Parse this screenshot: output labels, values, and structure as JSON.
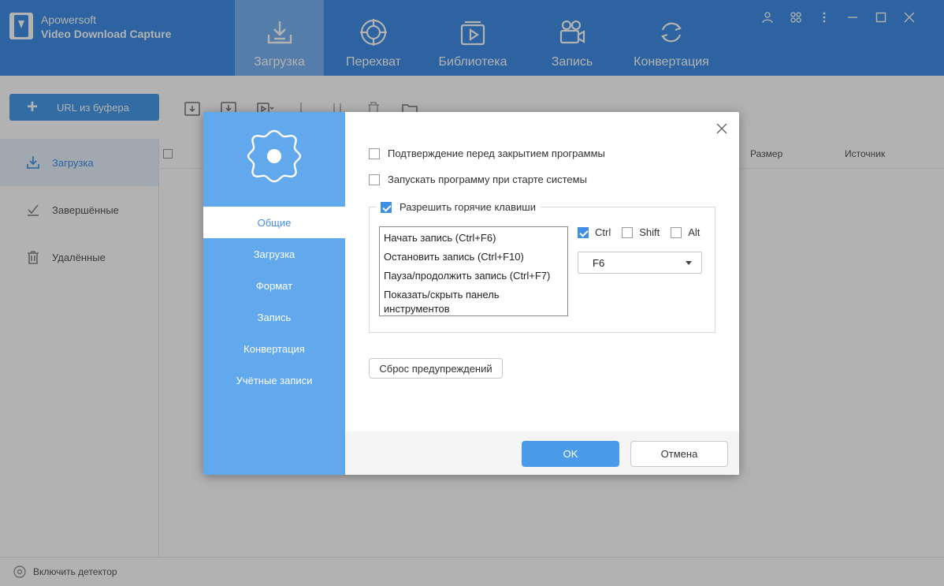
{
  "app": {
    "brand_line1": "Apowersoft",
    "brand_line2": "Video Download Capture",
    "tabs": [
      {
        "label": "Загрузка",
        "icon": "download-icon",
        "active": true
      },
      {
        "label": "Перехват",
        "icon": "crosshair-icon",
        "active": false
      },
      {
        "label": "Библиотека",
        "icon": "library-icon",
        "active": false
      },
      {
        "label": "Запись",
        "icon": "camera-icon",
        "active": false
      },
      {
        "label": "Конвертация",
        "icon": "convert-icon",
        "active": false
      }
    ],
    "url_button_label": "URL из буфера",
    "sidebar": [
      {
        "label": "Загрузка",
        "icon": "download-icon",
        "active": true
      },
      {
        "label": "Завершённые",
        "icon": "check-icon",
        "active": false
      },
      {
        "label": "Удалённые",
        "icon": "trash-icon",
        "active": false
      }
    ],
    "columns": {
      "size": "Размер",
      "source": "Источник"
    },
    "detector_label": "Включить детектор"
  },
  "dialog": {
    "menu": [
      {
        "label": "Общие",
        "active": true
      },
      {
        "label": "Загрузка",
        "active": false
      },
      {
        "label": "Формат",
        "active": false
      },
      {
        "label": "Запись",
        "active": false
      },
      {
        "label": "Конвертация",
        "active": false
      },
      {
        "label": "Учётные записи",
        "active": false
      }
    ],
    "confirm_exit_label": "Подтверждение перед закрытием программы",
    "confirm_exit_checked": false,
    "autostart_label": "Запускать программу при старте системы",
    "autostart_checked": false,
    "hotkeys_label": "Разрешить горячие клавиши",
    "hotkeys_checked": true,
    "hotkey_items": [
      "Начать запись (Ctrl+F6)",
      "Остановить запись (Ctrl+F10)",
      "Пауза/продолжить запись (Ctrl+F7)",
      "Показать/скрыть панель инструментов"
    ],
    "modifiers": [
      {
        "label": "Ctrl",
        "checked": true
      },
      {
        "label": "Shift",
        "checked": false
      },
      {
        "label": "Alt",
        "checked": false
      }
    ],
    "key_value": "F6",
    "reset_label": "Сброс предупреждений",
    "ok_label": "OK",
    "cancel_label": "Отмена",
    "colors": {
      "accent": "#3f8fe6",
      "side": "#61a8ec"
    }
  }
}
